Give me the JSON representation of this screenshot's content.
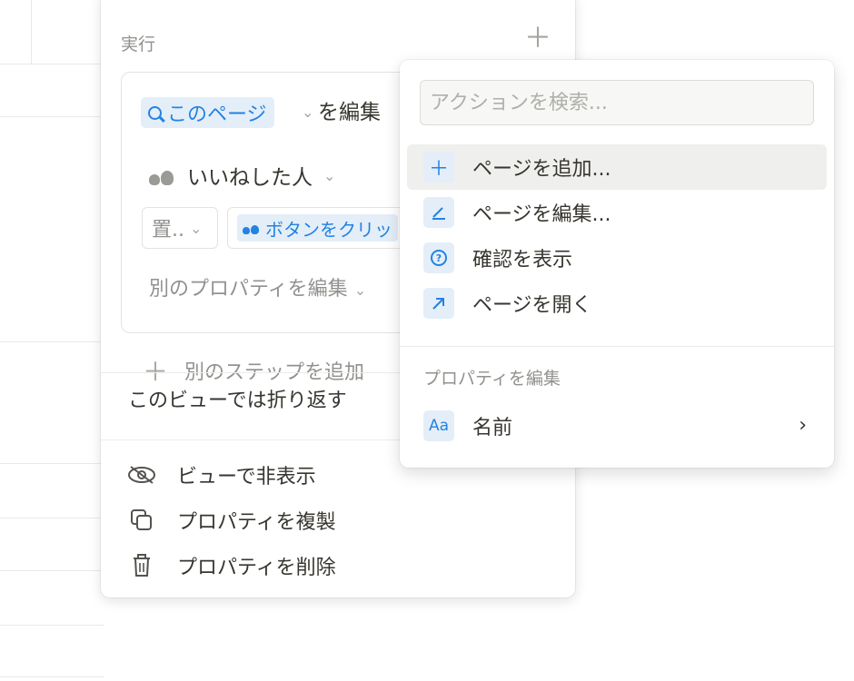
{
  "panel": {
    "run_label": "実行",
    "step": {
      "target_chip": "このページ",
      "edit_word": "を編集",
      "property_label": "いいねした人",
      "operation_value": "置..",
      "value_chip": "ボタンをクリッ",
      "other_property": "別のプロパティを編集"
    },
    "add_step": "別のステップを追加",
    "wrap_label": "このビューでは折り返す",
    "menu": [
      {
        "label": "ビューで非表示",
        "icon": "eye-slash-icon"
      },
      {
        "label": "プロパティを複製",
        "icon": "duplicate-icon"
      },
      {
        "label": "プロパティを削除",
        "icon": "trash-icon"
      }
    ]
  },
  "popup": {
    "search_placeholder": "アクションを検索...",
    "actions": [
      {
        "label": "ページを追加...",
        "icon": "plus-icon"
      },
      {
        "label": "ページを編集...",
        "icon": "pencil-icon"
      },
      {
        "label": "確認を表示",
        "icon": "question-circle-icon"
      },
      {
        "label": "ページを開く",
        "icon": "arrow-up-right-icon"
      }
    ],
    "section_label": "プロパティを編集",
    "property": {
      "icon_text": "Aa",
      "label": "名前"
    }
  },
  "colors": {
    "accent": "#2383e2",
    "chip_bg": "#e4eef8",
    "muted": "#91918e"
  }
}
